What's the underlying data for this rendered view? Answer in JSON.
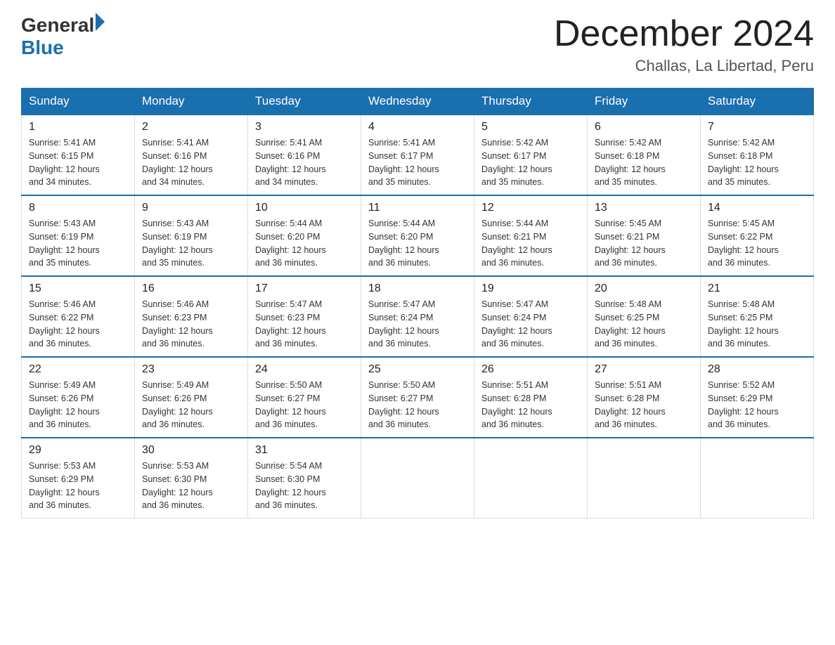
{
  "logo": {
    "text_general": "General",
    "text_blue": "Blue",
    "triangle_color": "#1a6faf"
  },
  "header": {
    "title": "December 2024",
    "subtitle": "Challas, La Libertad, Peru"
  },
  "weekdays": [
    "Sunday",
    "Monday",
    "Tuesday",
    "Wednesday",
    "Thursday",
    "Friday",
    "Saturday"
  ],
  "weeks": [
    [
      {
        "day": "1",
        "sunrise": "5:41 AM",
        "sunset": "6:15 PM",
        "daylight": "12 hours and 34 minutes."
      },
      {
        "day": "2",
        "sunrise": "5:41 AM",
        "sunset": "6:16 PM",
        "daylight": "12 hours and 34 minutes."
      },
      {
        "day": "3",
        "sunrise": "5:41 AM",
        "sunset": "6:16 PM",
        "daylight": "12 hours and 34 minutes."
      },
      {
        "day": "4",
        "sunrise": "5:41 AM",
        "sunset": "6:17 PM",
        "daylight": "12 hours and 35 minutes."
      },
      {
        "day": "5",
        "sunrise": "5:42 AM",
        "sunset": "6:17 PM",
        "daylight": "12 hours and 35 minutes."
      },
      {
        "day": "6",
        "sunrise": "5:42 AM",
        "sunset": "6:18 PM",
        "daylight": "12 hours and 35 minutes."
      },
      {
        "day": "7",
        "sunrise": "5:42 AM",
        "sunset": "6:18 PM",
        "daylight": "12 hours and 35 minutes."
      }
    ],
    [
      {
        "day": "8",
        "sunrise": "5:43 AM",
        "sunset": "6:19 PM",
        "daylight": "12 hours and 35 minutes."
      },
      {
        "day": "9",
        "sunrise": "5:43 AM",
        "sunset": "6:19 PM",
        "daylight": "12 hours and 35 minutes."
      },
      {
        "day": "10",
        "sunrise": "5:44 AM",
        "sunset": "6:20 PM",
        "daylight": "12 hours and 36 minutes."
      },
      {
        "day": "11",
        "sunrise": "5:44 AM",
        "sunset": "6:20 PM",
        "daylight": "12 hours and 36 minutes."
      },
      {
        "day": "12",
        "sunrise": "5:44 AM",
        "sunset": "6:21 PM",
        "daylight": "12 hours and 36 minutes."
      },
      {
        "day": "13",
        "sunrise": "5:45 AM",
        "sunset": "6:21 PM",
        "daylight": "12 hours and 36 minutes."
      },
      {
        "day": "14",
        "sunrise": "5:45 AM",
        "sunset": "6:22 PM",
        "daylight": "12 hours and 36 minutes."
      }
    ],
    [
      {
        "day": "15",
        "sunrise": "5:46 AM",
        "sunset": "6:22 PM",
        "daylight": "12 hours and 36 minutes."
      },
      {
        "day": "16",
        "sunrise": "5:46 AM",
        "sunset": "6:23 PM",
        "daylight": "12 hours and 36 minutes."
      },
      {
        "day": "17",
        "sunrise": "5:47 AM",
        "sunset": "6:23 PM",
        "daylight": "12 hours and 36 minutes."
      },
      {
        "day": "18",
        "sunrise": "5:47 AM",
        "sunset": "6:24 PM",
        "daylight": "12 hours and 36 minutes."
      },
      {
        "day": "19",
        "sunrise": "5:47 AM",
        "sunset": "6:24 PM",
        "daylight": "12 hours and 36 minutes."
      },
      {
        "day": "20",
        "sunrise": "5:48 AM",
        "sunset": "6:25 PM",
        "daylight": "12 hours and 36 minutes."
      },
      {
        "day": "21",
        "sunrise": "5:48 AM",
        "sunset": "6:25 PM",
        "daylight": "12 hours and 36 minutes."
      }
    ],
    [
      {
        "day": "22",
        "sunrise": "5:49 AM",
        "sunset": "6:26 PM",
        "daylight": "12 hours and 36 minutes."
      },
      {
        "day": "23",
        "sunrise": "5:49 AM",
        "sunset": "6:26 PM",
        "daylight": "12 hours and 36 minutes."
      },
      {
        "day": "24",
        "sunrise": "5:50 AM",
        "sunset": "6:27 PM",
        "daylight": "12 hours and 36 minutes."
      },
      {
        "day": "25",
        "sunrise": "5:50 AM",
        "sunset": "6:27 PM",
        "daylight": "12 hours and 36 minutes."
      },
      {
        "day": "26",
        "sunrise": "5:51 AM",
        "sunset": "6:28 PM",
        "daylight": "12 hours and 36 minutes."
      },
      {
        "day": "27",
        "sunrise": "5:51 AM",
        "sunset": "6:28 PM",
        "daylight": "12 hours and 36 minutes."
      },
      {
        "day": "28",
        "sunrise": "5:52 AM",
        "sunset": "6:29 PM",
        "daylight": "12 hours and 36 minutes."
      }
    ],
    [
      {
        "day": "29",
        "sunrise": "5:53 AM",
        "sunset": "6:29 PM",
        "daylight": "12 hours and 36 minutes."
      },
      {
        "day": "30",
        "sunrise": "5:53 AM",
        "sunset": "6:30 PM",
        "daylight": "12 hours and 36 minutes."
      },
      {
        "day": "31",
        "sunrise": "5:54 AM",
        "sunset": "6:30 PM",
        "daylight": "12 hours and 36 minutes."
      },
      null,
      null,
      null,
      null
    ]
  ],
  "labels": {
    "sunrise": "Sunrise:",
    "sunset": "Sunset:",
    "daylight": "Daylight: 12 hours"
  }
}
